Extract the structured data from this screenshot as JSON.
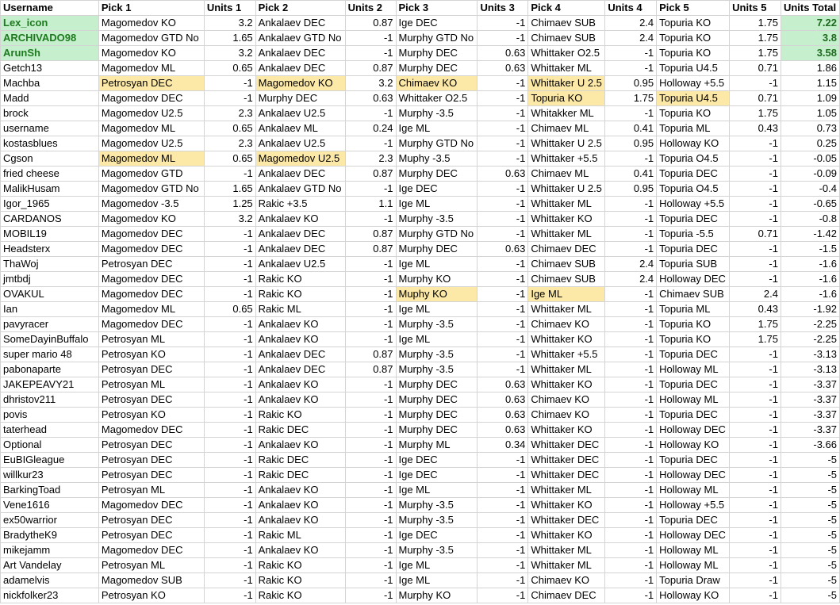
{
  "columns": [
    "Username",
    "Pick 1",
    "Units 1",
    "Pick 2",
    "Units 2",
    "Pick 3",
    "Units 3",
    "Pick 4",
    "Units 4",
    "Pick 5",
    "Units 5",
    "Units Total"
  ],
  "colors": {
    "highlight_yellow": "#fde9a7",
    "highlight_green": "#c6efce",
    "winner_text": "#1e7a1e",
    "grid": "#d4d4d4"
  },
  "rows": [
    {
      "cells": [
        "Lex_icon",
        "Magomedov KO",
        "3.2",
        "Ankalaev DEC",
        "0.87",
        "Ige DEC",
        "-1",
        "Chimaev SUB",
        "2.4",
        "Topuria KO",
        "1.75",
        "7.22"
      ],
      "winner": true,
      "hl": []
    },
    {
      "cells": [
        "ARCHIVADO98",
        "Magomedov GTD No",
        "1.65",
        "Ankalaev GTD No",
        "-1",
        "Murphy GTD No",
        "-1",
        "Chimaev SUB",
        "2.4",
        "Topuria KO",
        "1.75",
        "3.8"
      ],
      "winner": true,
      "hl": []
    },
    {
      "cells": [
        "ArunSh",
        "Magomedov KO",
        "3.2",
        "Ankalaev DEC",
        "-1",
        "Murphy DEC",
        "0.63",
        "Whittaker O2.5",
        "-1",
        "Topuria KO",
        "1.75",
        "3.58"
      ],
      "winner": true,
      "hl": []
    },
    {
      "cells": [
        "Getch13",
        "Magomedov ML",
        "0.65",
        "Ankalaev DEC",
        "0.87",
        "Murphy DEC",
        "0.63",
        "Whittaker ML",
        "-1",
        "Topuria U4.5",
        "0.71",
        "1.86"
      ],
      "hl": []
    },
    {
      "cells": [
        "Machba",
        "Petrosyan DEC",
        "-1",
        "Magomedov KO",
        "3.2",
        "Chimaev KO",
        "-1",
        "Whittaker U 2.5",
        "0.95",
        "Holloway +5.5",
        "-1",
        "1.15"
      ],
      "hl": [
        1,
        3,
        5,
        7
      ]
    },
    {
      "cells": [
        "Madd",
        "Magomedov DEC",
        "-1",
        "Murphy DEC",
        "0.63",
        "Whittaker O2.5",
        "-1",
        "Topuria KO",
        "1.75",
        "Topuria U4.5",
        "0.71",
        "1.09"
      ],
      "hl": [
        7,
        9
      ]
    },
    {
      "cells": [
        "brock",
        "Magomedov U2.5",
        "2.3",
        "Ankalaev U2.5",
        "-1",
        "Murphy -3.5",
        "-1",
        "Whitakker ML",
        "-1",
        "Topuria KO",
        "1.75",
        "1.05"
      ],
      "hl": []
    },
    {
      "cells": [
        "username",
        "Magomedov ML",
        "0.65",
        "Ankalaev ML",
        "0.24",
        "Ige ML",
        "-1",
        "Chimaev ML",
        "0.41",
        "Topuria ML",
        "0.43",
        "0.73"
      ],
      "hl": []
    },
    {
      "cells": [
        "kostasblues",
        "Magomedov U2.5",
        "2.3",
        "Ankalaev U2.5",
        "-1",
        "Murphy GTD No",
        "-1",
        "Whittaker U 2.5",
        "0.95",
        "Holloway KO",
        "-1",
        "0.25"
      ],
      "hl": []
    },
    {
      "cells": [
        "Cgson",
        "Magomedov ML",
        "0.65",
        "Magomedov U2.5",
        "2.3",
        "Muphy -3.5",
        "-1",
        "Whittaker +5.5",
        "-1",
        "Topuria O4.5",
        "-1",
        "-0.05"
      ],
      "hl": [
        1,
        3
      ]
    },
    {
      "cells": [
        "fried cheese",
        "Magomedov GTD",
        "-1",
        "Ankalaev DEC",
        "0.87",
        "Murphy DEC",
        "0.63",
        "Chimaev ML",
        "0.41",
        "Topuria DEC",
        "-1",
        "-0.09"
      ],
      "hl": []
    },
    {
      "cells": [
        "MalikHusam",
        "Magomedov GTD No",
        "1.65",
        "Ankalaev GTD No",
        "-1",
        "Ige DEC",
        "-1",
        "Whittaker U 2.5",
        "0.95",
        "Topuria O4.5",
        "-1",
        "-0.4"
      ],
      "hl": []
    },
    {
      "cells": [
        "Igor_1965",
        "Magomedov -3.5",
        "1.25",
        "Rakic +3.5",
        "1.1",
        "Ige ML",
        "-1",
        "Whittaker ML",
        "-1",
        "Holloway +5.5",
        "-1",
        "-0.65"
      ],
      "hl": []
    },
    {
      "cells": [
        "CARDANOS",
        "Magomedov KO",
        "3.2",
        "Ankalaev KO",
        "-1",
        "Murphy -3.5",
        "-1",
        "Whittaker KO",
        "-1",
        "Topuria DEC",
        "-1",
        "-0.8"
      ],
      "hl": []
    },
    {
      "cells": [
        "MOBIL19",
        "Magomedov DEC",
        "-1",
        "Ankalaev DEC",
        "0.87",
        "Murphy GTD No",
        "-1",
        "Whittaker ML",
        "-1",
        "Topuria -5.5",
        "0.71",
        "-1.42"
      ],
      "hl": []
    },
    {
      "cells": [
        "Headsterx",
        "Magomedov DEC",
        "-1",
        "Ankalaev DEC",
        "0.87",
        "Murphy DEC",
        "0.63",
        "Chimaev DEC",
        "-1",
        "Topuria DEC",
        "-1",
        "-1.5"
      ],
      "hl": []
    },
    {
      "cells": [
        "ThaWoj",
        "Petrosyan DEC",
        "-1",
        "Ankalaev U2.5",
        "-1",
        "Ige ML",
        "-1",
        "Chimaev SUB",
        "2.4",
        "Topuria SUB",
        "-1",
        "-1.6"
      ],
      "hl": []
    },
    {
      "cells": [
        "jmtbdj",
        "Magomedov DEC",
        "-1",
        "Rakic KO",
        "-1",
        "Murphy KO",
        "-1",
        "Chimaev SUB",
        "2.4",
        "Holloway DEC",
        "-1",
        "-1.6"
      ],
      "hl": []
    },
    {
      "cells": [
        "OVAKUL",
        "Magomedov DEC",
        "-1",
        "Rakic KO",
        "-1",
        "Muphy KO",
        "-1",
        "Ige ML",
        "-1",
        "Chimaev SUB",
        "2.4",
        "-1.6"
      ],
      "hl": [
        5,
        7
      ]
    },
    {
      "cells": [
        "Ian",
        "Magomedov ML",
        "0.65",
        "Rakic ML",
        "-1",
        "Ige ML",
        "-1",
        "Whittaker ML",
        "-1",
        "Topuria ML",
        "0.43",
        "-1.92"
      ],
      "hl": []
    },
    {
      "cells": [
        "pavyracer",
        "Magomedov DEC",
        "-1",
        "Ankalaev KO",
        "-1",
        "Murphy -3.5",
        "-1",
        "Chimaev KO",
        "-1",
        "Topuria KO",
        "1.75",
        "-2.25"
      ],
      "hl": []
    },
    {
      "cells": [
        "SomeDayinBuffalo",
        "Petrosyan ML",
        "-1",
        "Ankalaev KO",
        "-1",
        "Ige ML",
        "-1",
        "Whittaker KO",
        "-1",
        "Topuria KO",
        "1.75",
        "-2.25"
      ],
      "hl": []
    },
    {
      "cells": [
        "super mario 48",
        "Petrosyan KO",
        "-1",
        "Ankalaev DEC",
        "0.87",
        "Murphy -3.5",
        "-1",
        "Whittaker +5.5",
        "-1",
        "Topuria DEC",
        "-1",
        "-3.13"
      ],
      "hl": []
    },
    {
      "cells": [
        "pabonaparte",
        "Petrosyan DEC",
        "-1",
        "Ankalaev DEC",
        "0.87",
        "Murphy -3.5",
        "-1",
        "Whittaker ML",
        "-1",
        "Holloway ML",
        "-1",
        "-3.13"
      ],
      "hl": []
    },
    {
      "cells": [
        "JAKEPEAVY21",
        "Petrosyan ML",
        "-1",
        "Ankalaev KO",
        "-1",
        "Murphy DEC",
        "0.63",
        "Whittaker KO",
        "-1",
        "Topuria DEC",
        "-1",
        "-3.37"
      ],
      "hl": []
    },
    {
      "cells": [
        "dhristov211",
        "Petrosyan DEC",
        "-1",
        "Ankalaev KO",
        "-1",
        "Murphy DEC",
        "0.63",
        "Chimaev KO",
        "-1",
        "Holloway ML",
        "-1",
        "-3.37"
      ],
      "hl": []
    },
    {
      "cells": [
        "povis",
        "Petrosyan KO",
        "-1",
        "Rakic KO",
        "-1",
        "Murphy DEC",
        "0.63",
        "Chimaev KO",
        "-1",
        "Topuria DEC",
        "-1",
        "-3.37"
      ],
      "hl": []
    },
    {
      "cells": [
        "taterhead",
        "Magomedov DEC",
        "-1",
        "Rakic DEC",
        "-1",
        "Murphy DEC",
        "0.63",
        "Whittaker KO",
        "-1",
        "Holloway DEC",
        "-1",
        "-3.37"
      ],
      "hl": []
    },
    {
      "cells": [
        "Optional",
        "Petrosyan DEC",
        "-1",
        "Ankalaev KO",
        "-1",
        "Murphy ML",
        "0.34",
        "Whittaker DEC",
        "-1",
        "Holloway KO",
        "-1",
        "-3.66"
      ],
      "hl": []
    },
    {
      "cells": [
        "EuBIGleague",
        "Petrosyan DEC",
        "-1",
        "Rakic DEC",
        "-1",
        "Ige DEC",
        "-1",
        "Whittaker DEC",
        "-1",
        "Topuria DEC",
        "-1",
        "-5"
      ],
      "hl": []
    },
    {
      "cells": [
        "willkur23",
        "Petrosyan DEC",
        "-1",
        "Rakic DEC",
        "-1",
        "Ige DEC",
        "-1",
        "Whittaker DEC",
        "-1",
        "Holloway DEC",
        "-1",
        "-5"
      ],
      "hl": []
    },
    {
      "cells": [
        "BarkingToad",
        "Petrosyan ML",
        "-1",
        "Ankalaev KO",
        "-1",
        "Ige ML",
        "-1",
        "Whittaker ML",
        "-1",
        "Holloway ML",
        "-1",
        "-5"
      ],
      "hl": []
    },
    {
      "cells": [
        "Vene1616",
        "Magomedov DEC",
        "-1",
        "Ankalaev KO",
        "-1",
        "Murphy -3.5",
        "-1",
        "Whittaker KO",
        "-1",
        "Holloway +5.5",
        "-1",
        "-5"
      ],
      "hl": []
    },
    {
      "cells": [
        "ex50warrior",
        "Petrosyan DEC",
        "-1",
        "Ankalaev KO",
        "-1",
        "Murphy -3.5",
        "-1",
        "Whittaker DEC",
        "-1",
        "Topuria DEC",
        "-1",
        "-5"
      ],
      "hl": []
    },
    {
      "cells": [
        "BradytheK9",
        "Petrosyan DEC",
        "-1",
        "Rakic ML",
        "-1",
        "Ige DEC",
        "-1",
        "Whittaker KO",
        "-1",
        "Holloway DEC",
        "-1",
        "-5"
      ],
      "hl": []
    },
    {
      "cells": [
        "mikejamm",
        "Magomedov DEC",
        "-1",
        "Ankalaev KO",
        "-1",
        "Murphy -3.5",
        "-1",
        "Whittaker ML",
        "-1",
        "Holloway ML",
        "-1",
        "-5"
      ],
      "hl": []
    },
    {
      "cells": [
        "Art Vandelay",
        "Petrosyan ML",
        "-1",
        "Rakic KO",
        "-1",
        "Ige ML",
        "-1",
        "Whittaker ML",
        "-1",
        "Holloway ML",
        "-1",
        "-5"
      ],
      "hl": []
    },
    {
      "cells": [
        "adamelvis",
        "Magomedov SUB",
        "-1",
        "Rakic KO",
        "-1",
        "Ige ML",
        "-1",
        "Chimaev KO",
        "-1",
        "Topuria Draw",
        "-1",
        "-5"
      ],
      "hl": []
    },
    {
      "cells": [
        "nickfolker23",
        "Petrosyan KO",
        "-1",
        "Rakic KO",
        "-1",
        "Murphy KO",
        "-1",
        "Chimaev DEC",
        "-1",
        "Holloway KO",
        "-1",
        "-5"
      ],
      "hl": []
    }
  ]
}
